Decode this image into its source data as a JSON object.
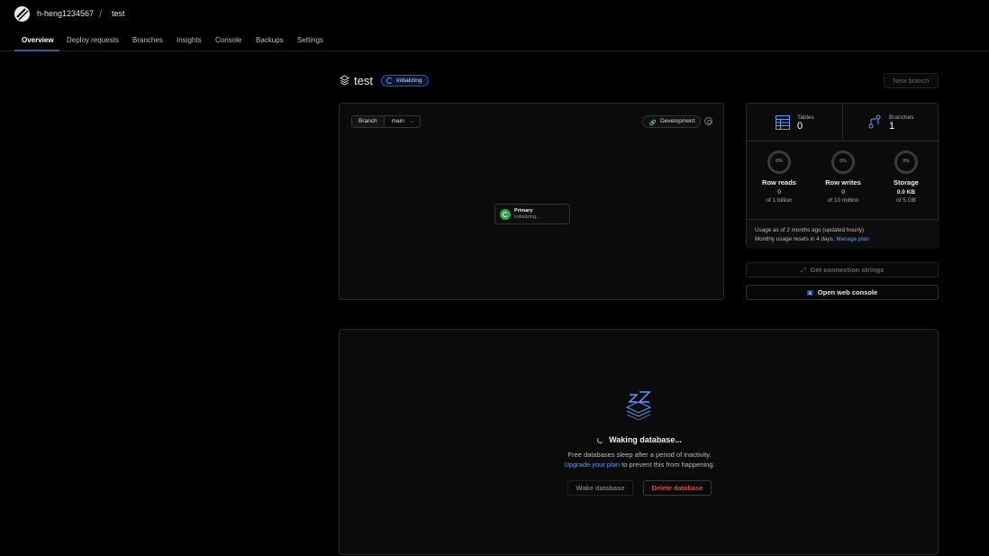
{
  "breadcrumb": {
    "org": "h-heng1234567",
    "separator": "/",
    "database": "test"
  },
  "nav": {
    "items": [
      {
        "label": "Overview",
        "active": true
      },
      {
        "label": "Deploy requests"
      },
      {
        "label": "Branches"
      },
      {
        "label": "Insights"
      },
      {
        "label": "Console"
      },
      {
        "label": "Backups"
      },
      {
        "label": "Settings"
      }
    ]
  },
  "header": {
    "title": "test",
    "status": "Initializing",
    "new_branch_label": "New branch"
  },
  "branch_panel": {
    "branch_label": "Branch",
    "branch_value": "main",
    "environment": "Development",
    "node": {
      "name": "Primary",
      "status": "Initializing..."
    }
  },
  "stats": {
    "tables_label": "Tables",
    "tables_value": "0",
    "branches_label": "Branches",
    "branches_value": "1",
    "usage": [
      {
        "percent": "0%",
        "title": "Row reads",
        "value": "0",
        "limit": "of 1 billion"
      },
      {
        "percent": "0%",
        "title": "Row writes",
        "value": "0",
        "limit": "of 10 million"
      },
      {
        "percent": "0%",
        "title": "Storage",
        "value": "0.0 KB",
        "limit": "of 5 GB"
      }
    ],
    "footer_line1": "Usage as of 2 months ago (updated hourly)",
    "footer_line2": "Monthly usage resets in 4 days.",
    "footer_link": "Manage plan"
  },
  "actions": {
    "connection_strings": "Get connection strings",
    "web_console": "Open web console"
  },
  "sleep": {
    "title": "Waking database...",
    "line1": "Free databases sleep after a period of inactivity.",
    "link": "Upgrade your plan",
    "line2_rest": "to prevent this from happening.",
    "wake_label": "Wake database",
    "delete_label": "Delete database"
  },
  "colors": {
    "accent": "#2f5ea8",
    "link": "#5e9bff",
    "danger": "#e0473f",
    "success": "#2aa84a"
  }
}
